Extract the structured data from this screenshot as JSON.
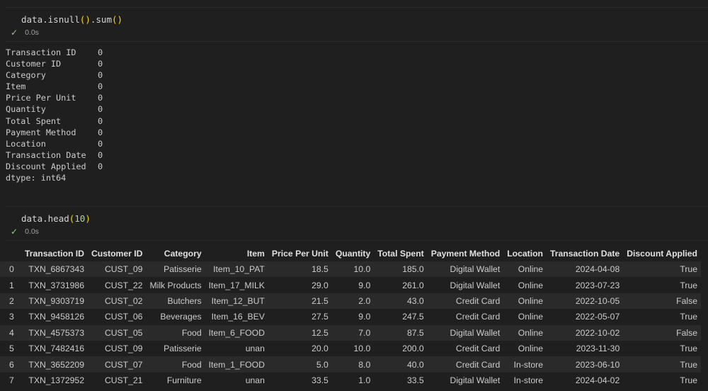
{
  "cell1": {
    "code": {
      "obj": "data",
      "m1": "isnull",
      "m2": "sum"
    },
    "status": {
      "check": "✓",
      "time": "0.0s"
    },
    "output": [
      {
        "key": "Transaction ID",
        "val": "0"
      },
      {
        "key": "Customer ID",
        "val": "0"
      },
      {
        "key": "Category",
        "val": "0"
      },
      {
        "key": "Item",
        "val": "0"
      },
      {
        "key": "Price Per Unit",
        "val": "0"
      },
      {
        "key": "Quantity",
        "val": "0"
      },
      {
        "key": "Total Spent",
        "val": "0"
      },
      {
        "key": "Payment Method",
        "val": "0"
      },
      {
        "key": "Location",
        "val": "0"
      },
      {
        "key": "Transaction Date",
        "val": "0"
      },
      {
        "key": "Discount Applied",
        "val": "0"
      }
    ],
    "dtype": "dtype: int64"
  },
  "cell2": {
    "code": {
      "obj": "data",
      "m1": "head",
      "arg": "10"
    },
    "status": {
      "check": "✓",
      "time": "0.0s"
    },
    "table": {
      "columns": [
        "",
        "Transaction ID",
        "Customer ID",
        "Category",
        "Item",
        "Price Per Unit",
        "Quantity",
        "Total Spent",
        "Payment Method",
        "Location",
        "Transaction Date",
        "Discount Applied"
      ],
      "rows": [
        [
          "0",
          "TXN_6867343",
          "CUST_09",
          "Patisserie",
          "Item_10_PAT",
          "18.5",
          "10.0",
          "185.0",
          "Digital Wallet",
          "Online",
          "2024-04-08",
          "True"
        ],
        [
          "1",
          "TXN_3731986",
          "CUST_22",
          "Milk Products",
          "Item_17_MILK",
          "29.0",
          "9.0",
          "261.0",
          "Digital Wallet",
          "Online",
          "2023-07-23",
          "True"
        ],
        [
          "2",
          "TXN_9303719",
          "CUST_02",
          "Butchers",
          "Item_12_BUT",
          "21.5",
          "2.0",
          "43.0",
          "Credit Card",
          "Online",
          "2022-10-05",
          "False"
        ],
        [
          "3",
          "TXN_9458126",
          "CUST_06",
          "Beverages",
          "Item_16_BEV",
          "27.5",
          "9.0",
          "247.5",
          "Credit Card",
          "Online",
          "2022-05-07",
          "True"
        ],
        [
          "4",
          "TXN_4575373",
          "CUST_05",
          "Food",
          "Item_6_FOOD",
          "12.5",
          "7.0",
          "87.5",
          "Digital Wallet",
          "Online",
          "2022-10-02",
          "False"
        ],
        [
          "5",
          "TXN_7482416",
          "CUST_09",
          "Patisserie",
          "unan",
          "20.0",
          "10.0",
          "200.0",
          "Credit Card",
          "Online",
          "2023-11-30",
          "True"
        ],
        [
          "6",
          "TXN_3652209",
          "CUST_07",
          "Food",
          "Item_1_FOOD",
          "5.0",
          "8.0",
          "40.0",
          "Credit Card",
          "In-store",
          "2023-06-10",
          "True"
        ],
        [
          "7",
          "TXN_1372952",
          "CUST_21",
          "Furniture",
          "unan",
          "33.5",
          "1.0",
          "33.5",
          "Digital Wallet",
          "In-store",
          "2024-04-02",
          "True"
        ]
      ]
    }
  }
}
